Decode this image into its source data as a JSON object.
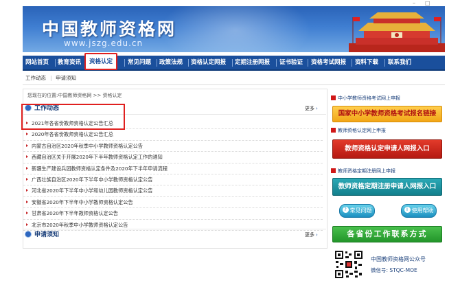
{
  "window": {
    "minimize": "–",
    "maximize": "□"
  },
  "banner": {
    "site_title": "中国教师资格网",
    "site_url": "www.jszg.edu.cn"
  },
  "nav": {
    "items": [
      "网站首页",
      "教育资讯",
      "资格认定",
      "常见问题",
      "政策法规",
      "资格认定网报",
      "定期注册网报",
      "证书验证",
      "资格考试网报",
      "资料下载",
      "联系我们"
    ],
    "active_index": 2
  },
  "subnav": {
    "items": [
      "工作动态",
      "申请须知"
    ]
  },
  "breadcrumb": "您现在的位置:中国教师资格网 >> 资格认定",
  "work_news": {
    "title": "工作动态",
    "more": "更多",
    "items": [
      "2021年各省份教师资格认定公告汇总",
      "2020年各省份教师资格认定公告汇总",
      "内蒙古自治区2020年秋季中小学教师资格认定公告",
      "西藏自治区关于开展2020年下半年教师资格认定工作的通知",
      "新疆生产建设兵团教师资格认定条件及2020年下半年申请流程",
      "广西壮族自治区2020年下半年中小学教师资格认定公告",
      "河北省2020年下半年中小学和幼儿园教师资格认定公告",
      "安徽省2020年下半年中小学教师资格认定公告",
      "甘肃省2020年下半年教师资格认定公告",
      "北京市2020年秋季中小学教师资格认定公告"
    ]
  },
  "apply_notice": {
    "title": "申请须知",
    "more": "更多"
  },
  "sidebar": {
    "exam_head": "中小学教师资格考试网上申报",
    "exam_button": "国家中小学教师资格考试报名链接",
    "cert_head": "教师资格认定网上申报",
    "cert_button": "教师资格认定申请人网报入口",
    "renew_head": "教师资格定期注册网上申报",
    "renew_button": "教师资格定期注册申请人网报入口",
    "faq_button": "常见问题",
    "guide_button": "使用帮助",
    "contact_button": "各省份工作联系方式",
    "wechat_title": "中国教师资格网公众号",
    "wechat_id": "微信号: STQC-MOE"
  },
  "colors": {
    "nav_bg": "#1a4f9c",
    "highlight": "#e0201f",
    "accent_red": "#c7282b"
  }
}
